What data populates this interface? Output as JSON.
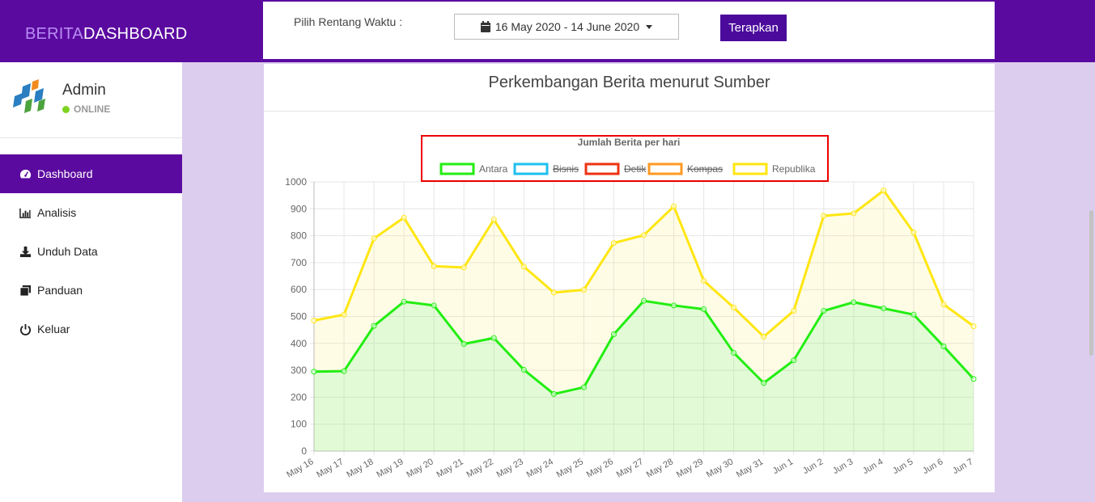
{
  "brand": {
    "part1": "BERITA",
    "part2": "DASHBOARD"
  },
  "filter": {
    "label": "Pilih Rentang Waktu :",
    "date_range": "16 May 2020 - 14 June 2020",
    "apply_label": "Terapkan"
  },
  "user": {
    "name": "Admin",
    "status": "ONLINE"
  },
  "menu": [
    {
      "label": "Dashboard",
      "icon": "dashboard-icon",
      "active": true
    },
    {
      "label": "Analisis",
      "icon": "bar-chart-icon",
      "active": false
    },
    {
      "label": "Unduh Data",
      "icon": "download-icon",
      "active": false
    },
    {
      "label": "Panduan",
      "icon": "book-icon",
      "active": false
    },
    {
      "label": "Keluar",
      "icon": "power-icon",
      "active": false
    }
  ],
  "colors": {
    "brand": "#5b0aa0",
    "antara": "#22ee11",
    "bisnis": "#1ec0ee",
    "detik": "#ee3311",
    "kompas": "#ff9922",
    "republika": "#ffe611",
    "highlight": "#ee0000"
  },
  "panel": {
    "title": "Perkembangan Berita menurut Sumber"
  },
  "chart_data": {
    "type": "area",
    "title": "Jumlah Berita per hari",
    "categories": [
      "May 16",
      "May 17",
      "May 18",
      "May 19",
      "May 20",
      "May 21",
      "May 22",
      "May 23",
      "May 24",
      "May 25",
      "May 26",
      "May 27",
      "May 28",
      "May 29",
      "May 30",
      "May 31",
      "Jun 1",
      "Jun 2",
      "Jun 3",
      "Jun 4",
      "Jun 5",
      "Jun 6",
      "Jun 7"
    ],
    "ylim": [
      0,
      1000
    ],
    "yticks": [
      "0",
      "100",
      "200",
      "300",
      "400",
      "500",
      "600",
      "700",
      "800",
      "900",
      "1000"
    ],
    "stacked": true,
    "grid": true,
    "legend_position": "top",
    "legend": [
      {
        "name": "Antara",
        "hidden": false
      },
      {
        "name": "Bisnis",
        "hidden": true
      },
      {
        "name": "Detik",
        "hidden": true
      },
      {
        "name": "Kompas",
        "hidden": true
      },
      {
        "name": "Republika",
        "hidden": false
      }
    ],
    "series": [
      {
        "name": "Antara",
        "values": [
          295,
          297,
          465,
          555,
          541,
          398,
          420,
          302,
          212,
          237,
          434,
          558,
          541,
          527,
          365,
          253,
          337,
          521,
          553,
          530,
          507,
          389,
          268
        ]
      },
      {
        "name": "Republika",
        "values": [
          190,
          210,
          325,
          312,
          146,
          284,
          440,
          383,
          377,
          362,
          339,
          244,
          368,
          106,
          168,
          172,
          184,
          353,
          330,
          438,
          305,
          156,
          196
        ]
      }
    ]
  }
}
